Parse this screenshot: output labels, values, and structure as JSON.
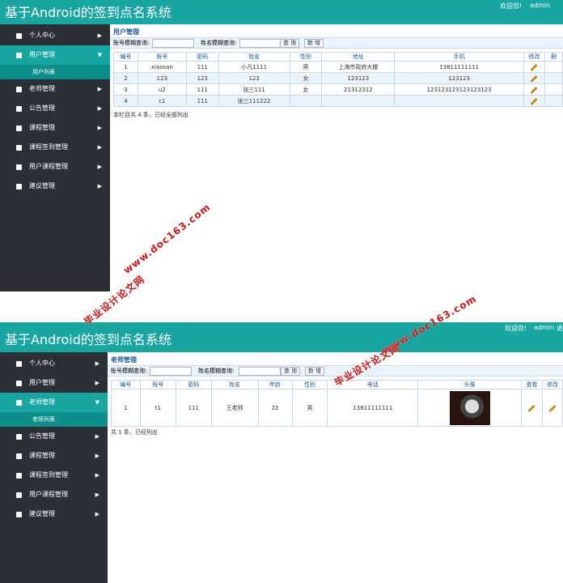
{
  "app_title": "基于Android的签到点名系统",
  "welcome": "欢迎您!",
  "admin_name": "admin",
  "logout": "退",
  "menu": [
    {
      "label": "个人中心",
      "icon": "user-icon"
    },
    {
      "label": "用户管理",
      "icon": "users-icon"
    },
    {
      "label": "老师管理",
      "icon": "teacher-icon"
    },
    {
      "label": "公告管理",
      "icon": "notice-icon"
    },
    {
      "label": "课程管理",
      "icon": "course-icon"
    },
    {
      "label": "课程签到管理",
      "icon": "checkin-icon"
    },
    {
      "label": "用户课程管理",
      "icon": "user-course-icon"
    },
    {
      "label": "建议管理",
      "icon": "suggestion-icon"
    }
  ],
  "chevron_right": "▶",
  "chevron_down": "▼",
  "screen1": {
    "submenu": "用户列表",
    "panel_title": "用户管理",
    "search_account_label": "账号模糊查询:",
    "search_name_label": "姓名模糊查询:",
    "query_button": "查 询",
    "new_button": "新 增",
    "columns": [
      "编号",
      "账号",
      "密码",
      "姓名",
      "性别",
      "地址",
      "手机",
      "修改",
      "删"
    ],
    "rows": [
      [
        "1",
        "xiaosan",
        "111",
        "小凡1111",
        "男",
        "上海市政府大楼",
        "13811111111"
      ],
      [
        "2",
        "123",
        "123",
        "123",
        "女",
        "123123",
        "123123"
      ],
      [
        "3",
        "u2",
        "111",
        "张三111",
        "女",
        "21312312",
        "123123123123123123"
      ],
      [
        "4",
        "c1",
        "111",
        "张三111222",
        "",
        "",
        ""
      ]
    ],
    "footer": "本栏目共 4 条，已经全部列出"
  },
  "screen2": {
    "submenu": "老师列表",
    "panel_title": "老师管理",
    "search_account_label": "账号模糊查询:",
    "search_name_label": "姓名模糊查询:",
    "query_button": "查 询",
    "new_button": "新 增",
    "columns": [
      "编号",
      "账号",
      "密码",
      "姓名",
      "年龄",
      "性别",
      "电话",
      "头像",
      "查看",
      "修改"
    ],
    "rows": [
      [
        "1",
        "t1",
        "111",
        "王老师",
        "22",
        "男",
        "13811111111"
      ]
    ],
    "footer": "共 1 条，已经列出"
  },
  "watermark": {
    "site": "www.doc163.com",
    "name": "毕业设计论文网"
  },
  "colors": {
    "teal": "#17a6a1",
    "sidebar": "#2c2f36",
    "watermark": "#d41414"
  }
}
